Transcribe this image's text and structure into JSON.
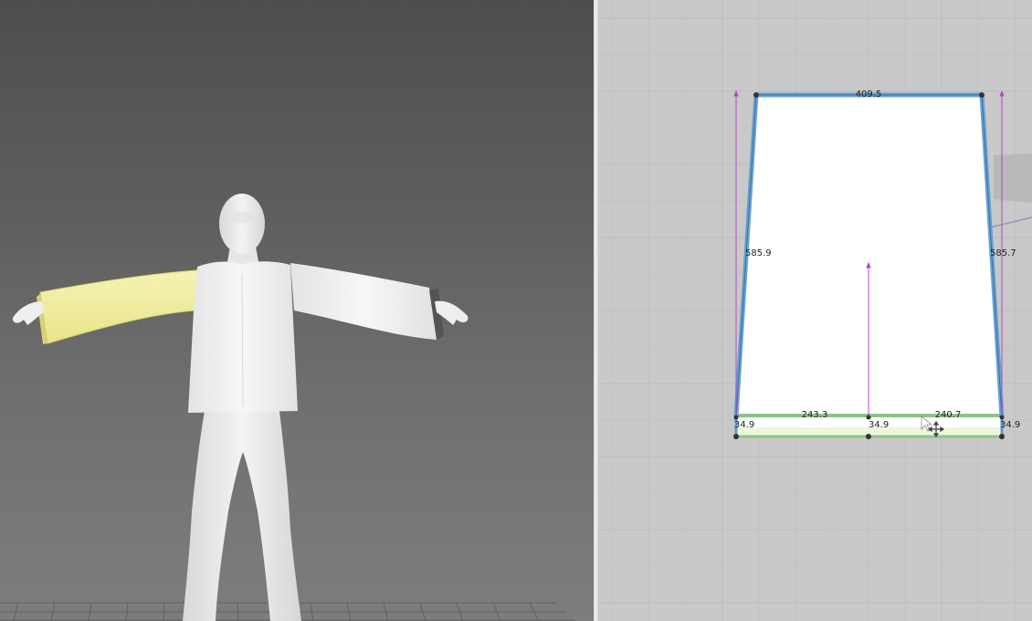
{
  "colors": {
    "avatar": "#ededed",
    "garment": "#f4f4f4",
    "selected_piece": "#f1ee9c",
    "pattern_outline": "#5b9bd1",
    "hem_band": "#8cc48a",
    "measure_line": "#b04cc0",
    "grid_line": "#bdbdbd",
    "workspace_bg": "#c9c9c9"
  },
  "icons": {
    "cursor": "arrow-cursor-icon",
    "move": "move-cross-icon"
  },
  "pattern_editor": {
    "measurements": {
      "top_width": "409.5",
      "left_side_length": "585.9",
      "right_side_length": "585.7",
      "bottom_left_width": "243.3",
      "bottom_right_width": "240.7",
      "band_left_height": "34.9",
      "band_center_height": "34.9",
      "band_right_height": "34.9"
    }
  }
}
